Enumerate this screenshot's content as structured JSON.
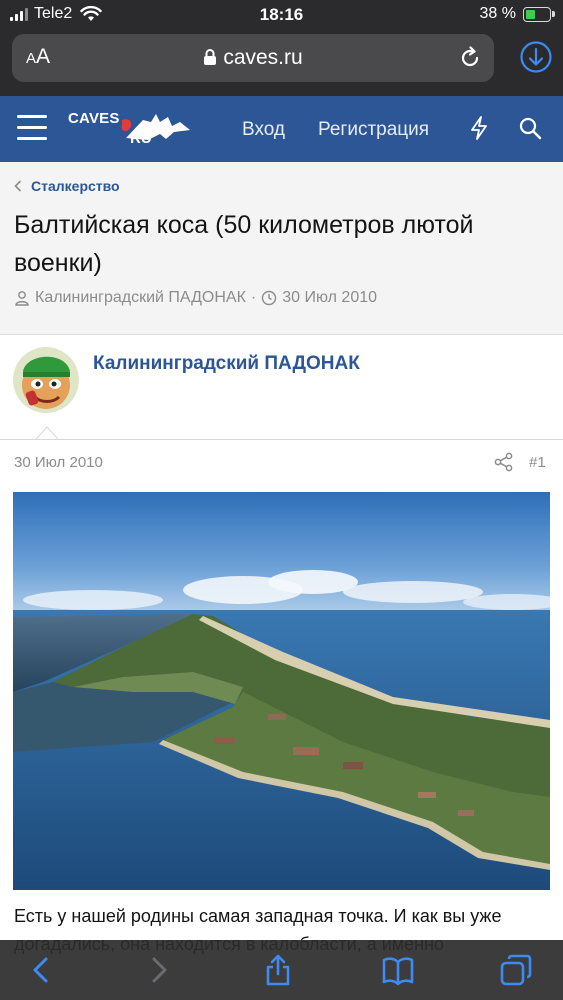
{
  "status_bar": {
    "carrier": "Tele2",
    "time": "18:16",
    "battery_percent": "38 %",
    "battery_level": 0.38
  },
  "browser": {
    "text_size_label": "AA",
    "url": "caves.ru",
    "icons": [
      "lock-icon",
      "reload-icon",
      "download-icon"
    ]
  },
  "site": {
    "logo_top": "CAVES",
    "logo_bottom": "RU",
    "nav": {
      "login": "Вход",
      "register": "Регистрация"
    },
    "accent_color": "#2d5696"
  },
  "thread": {
    "breadcrumb": "Сталкерство",
    "title": "Балтийская коса (50 километров лютой военки)",
    "author": "Калининградский ПАДОНАК",
    "date": "30 Июл 2010"
  },
  "post": {
    "author": "Калининградский ПАДОНАК",
    "date": "30 Июл 2010",
    "number": "#1",
    "text": "Есть у нашей родины самая западная точка. И как вы уже догадались, она находится в калобласти, а именно"
  },
  "toolbar": {
    "icons": [
      "back-icon",
      "forward-icon",
      "share-icon",
      "bookmarks-icon",
      "tabs-icon"
    ]
  }
}
